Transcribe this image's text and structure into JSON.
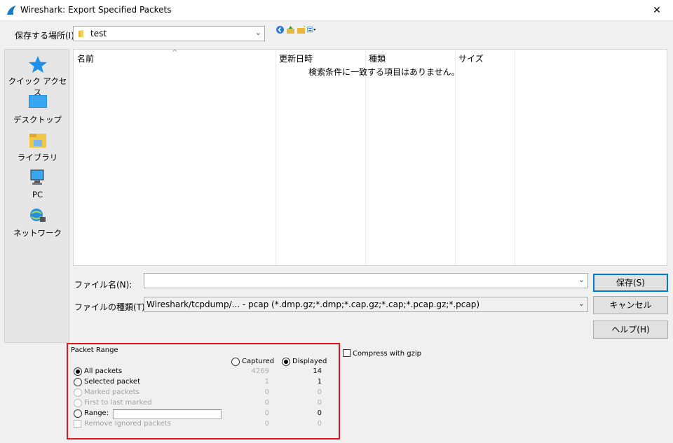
{
  "window": {
    "title": "Wireshark: Export Specified Packets",
    "close_glyph": "✕"
  },
  "location": {
    "label": "保存する場所(I):",
    "value": "test"
  },
  "toolbar": {
    "icons": [
      "back-icon",
      "up-folder-icon",
      "new-folder-icon",
      "view-menu-icon"
    ]
  },
  "places": [
    {
      "label": "クイック アクセス",
      "icon": "star-icon"
    },
    {
      "label": "デスクトップ",
      "icon": "desktop-icon"
    },
    {
      "label": "ライブラリ",
      "icon": "library-icon"
    },
    {
      "label": "PC",
      "icon": "pc-icon"
    },
    {
      "label": "ネットワーク",
      "icon": "network-icon"
    }
  ],
  "filelist": {
    "columns": [
      "名前",
      "更新日時",
      "種類",
      "サイズ"
    ],
    "empty_message": "検索条件に一致する項目はありません。"
  },
  "filename": {
    "label": "ファイル名(N):",
    "value": ""
  },
  "filetype": {
    "label": "ファイルの種類(T):",
    "value": "Wireshark/tcpdump/... - pcap (*.dmp.gz;*.dmp;*.cap.gz;*.cap;*.pcap.gz;*.pcap)"
  },
  "buttons": {
    "save": "保存(S)",
    "cancel": "キャンセル",
    "help": "ヘルプ(H)"
  },
  "packet_range": {
    "title": "Packet Range",
    "captured_label": "Captured",
    "displayed_label": "Displayed",
    "selected_column": "Displayed",
    "rows": [
      {
        "label": "All packets",
        "captured": "4269",
        "displayed": "14",
        "selected": true,
        "enabled": true
      },
      {
        "label": "Selected packet",
        "captured": "1",
        "displayed": "1",
        "selected": false,
        "enabled": true
      },
      {
        "label": "Marked packets",
        "captured": "0",
        "displayed": "0",
        "selected": false,
        "enabled": false
      },
      {
        "label": "First to last marked",
        "captured": "0",
        "displayed": "0",
        "selected": false,
        "enabled": false
      },
      {
        "label": "Range:",
        "captured": "0",
        "displayed": "0",
        "selected": false,
        "enabled": true
      },
      {
        "label": "Remove Ignored packets",
        "captured": "0",
        "displayed": "0",
        "selected": false,
        "enabled": false
      }
    ],
    "range_value": ""
  },
  "gzip": {
    "label": "Compress with gzip",
    "checked": false
  },
  "colors": {
    "highlight_border": "#e2141e",
    "accent": "#0078d7"
  }
}
